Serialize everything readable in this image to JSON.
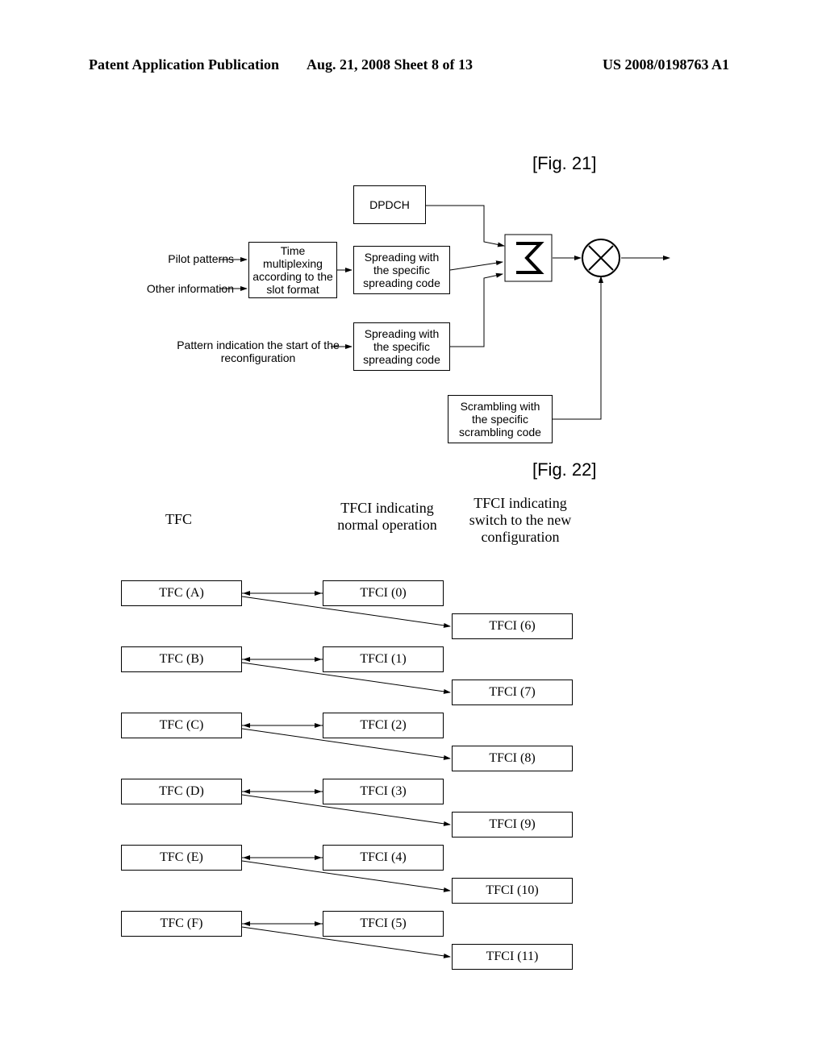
{
  "header": {
    "left": "Patent Application Publication",
    "center": "Aug. 21, 2008  Sheet 8 of 13",
    "right": "US 2008/0198763 A1"
  },
  "fig21": {
    "label": "[Fig. 21]",
    "pilot": "Pilot patterns",
    "other": "Other information",
    "mux": "Time\nmultiplexing\naccording to the\nslot format",
    "dpdch": "DPDCH",
    "spread1": "Spreading with\nthe specific\nspreading code",
    "spread2": "Spreading with\nthe specific\nspreading code",
    "pattern": "Pattern indication the start of the\nreconfiguration",
    "scramble": "Scrambling with\nthe specific\nscrambling code"
  },
  "fig22": {
    "label": "[Fig. 22]",
    "col1": "TFC",
    "col2": "TFCI indicating\nnormal operation",
    "col3": "TFCI indicating\nswitch to the new\nconfiguration",
    "tfc": [
      "TFC (A)",
      "TFC (B)",
      "TFC (C)",
      "TFC (D)",
      "TFC (E)",
      "TFC (F)"
    ],
    "tfci_a": [
      "TFCI (0)",
      "TFCI (1)",
      "TFCI (2)",
      "TFCI (3)",
      "TFCI (4)",
      "TFCI (5)"
    ],
    "tfci_b": [
      "TFCI (6)",
      "TFCI (7)",
      "TFCI (8)",
      "TFCI (9)",
      "TFCI (10)",
      "TFCI (11)"
    ]
  }
}
